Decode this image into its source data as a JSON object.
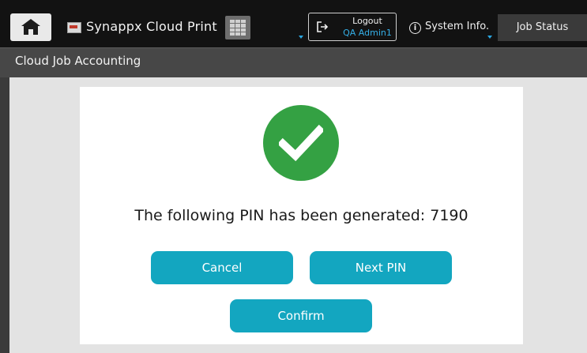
{
  "topbar": {
    "home_icon": "home-icon",
    "app_icon": "app-icon",
    "app_title": "Synappx Cloud Print",
    "keypad_icon": "keypad-icon",
    "logout": {
      "icon": "logout-icon",
      "label": "Logout",
      "user": "QA Admin1"
    },
    "system_info": {
      "icon": "info-icon",
      "label": "System Info."
    },
    "job_status_label": "Job Status"
  },
  "subheader": {
    "title": "Cloud Job Accounting"
  },
  "dialog": {
    "success_icon": "checkmark-icon",
    "message": "The following PIN has been generated: 7190",
    "buttons": {
      "cancel": "Cancel",
      "next_pin": "Next PIN",
      "confirm": "Confirm"
    }
  },
  "colors": {
    "accent": "#13a6c0",
    "success": "#34a143",
    "user_text": "#35b0e8"
  }
}
